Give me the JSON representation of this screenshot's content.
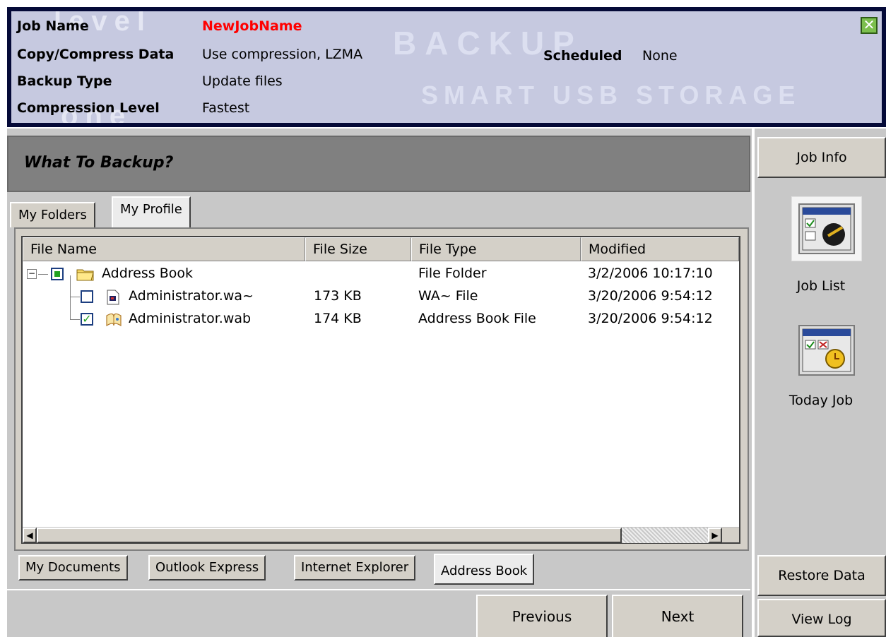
{
  "header": {
    "job_name_label": "Job Name",
    "job_name_value": "NewJobName",
    "copy_compress_label": "Copy/Compress Data",
    "copy_compress_value": "Use compression, LZMA",
    "backup_type_label": "Backup Type",
    "backup_type_value": "Update files",
    "compression_level_label": "Compression Level",
    "compression_level_value": "Fastest",
    "scheduled_label": "Scheduled",
    "scheduled_value": "None",
    "watermark_backup": "BACKUP",
    "watermark_smart": "SMART USB STORAGE",
    "watermark_level": "level",
    "watermark_one": "one"
  },
  "section_title": "What To Backup?",
  "top_tabs": [
    "My Folders",
    "My Profile"
  ],
  "top_tabs_selected": "My Profile",
  "table": {
    "columns": [
      "File Name",
      "File Size",
      "File Type",
      "Modified"
    ],
    "rows": [
      {
        "name": "Address Book",
        "size": "",
        "type": "File Folder",
        "modified": "3/2/2006 10:17:10",
        "checkbox": "partial",
        "icon": "folder-icon",
        "level": 0
      },
      {
        "name": "Administrator.wa~",
        "size": "173 KB",
        "type": "WA~ File",
        "modified": "3/20/2006 9:54:12",
        "checkbox": "unchecked",
        "icon": "file-icon",
        "level": 1
      },
      {
        "name": "Administrator.wab",
        "size": "174 KB",
        "type": "Address Book File",
        "modified": "3/20/2006 9:54:12",
        "checkbox": "checked",
        "icon": "address-book-icon",
        "level": 1
      }
    ]
  },
  "bottom_tabs": [
    "My Documents",
    "Outlook Express",
    "Internet Explorer",
    "Address Book"
  ],
  "bottom_tabs_selected": "Address Book",
  "nav": {
    "previous": "Previous",
    "next": "Next"
  },
  "sidebar": {
    "job_info": "Job Info",
    "job_list": "Job List",
    "today_job": "Today Job",
    "restore_data": "Restore Data",
    "view_log": "View Log"
  },
  "colors": {
    "header_border": "#050a38",
    "header_bg": "#c6c9e0",
    "job_name": "#ff0000",
    "checkbox_green": "#21a121"
  }
}
